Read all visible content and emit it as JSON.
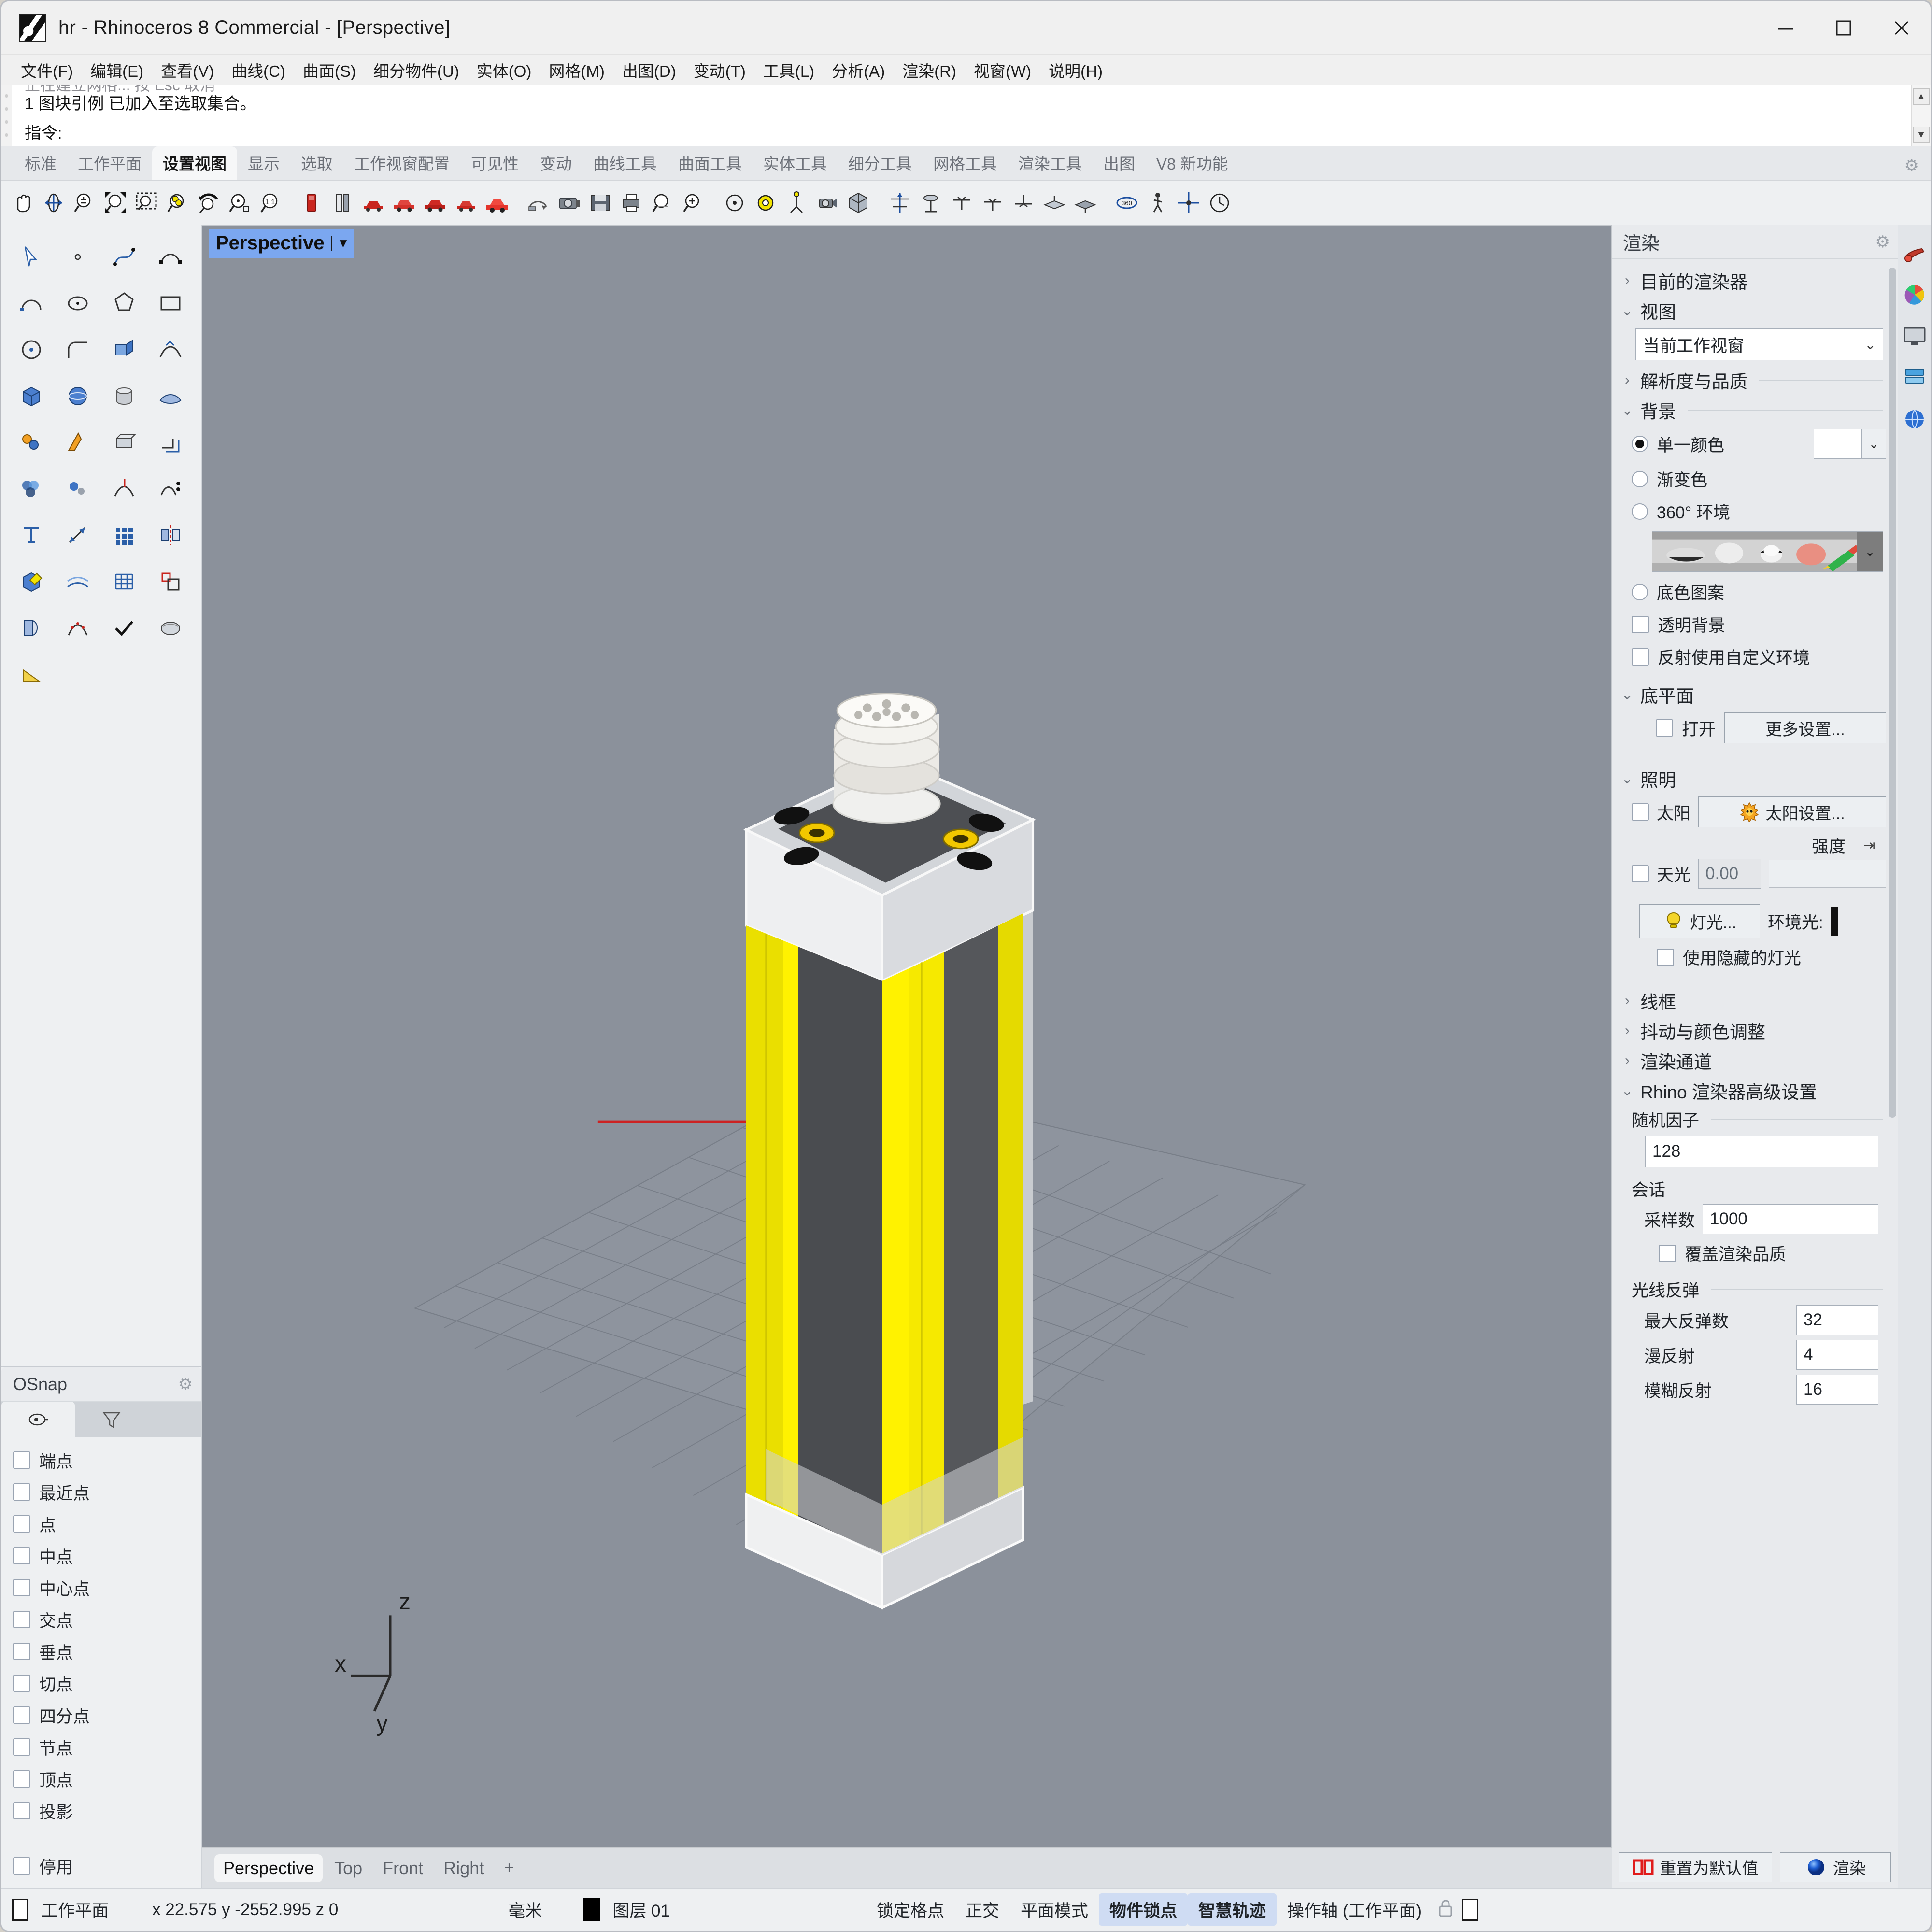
{
  "window": {
    "title": "hr - Rhinoceros 8 Commercial - [Perspective]",
    "minimize_label": "minimize",
    "maximize_label": "maximize",
    "close_label": "close"
  },
  "menubar": {
    "items": [
      {
        "label": "文件(F)"
      },
      {
        "label": "编辑(E)"
      },
      {
        "label": "查看(V)"
      },
      {
        "label": "曲线(C)"
      },
      {
        "label": "曲面(S)"
      },
      {
        "label": "细分物件(U)"
      },
      {
        "label": "实体(O)"
      },
      {
        "label": "网格(M)"
      },
      {
        "label": "出图(D)"
      },
      {
        "label": "变动(T)"
      },
      {
        "label": "工具(L)"
      },
      {
        "label": "分析(A)"
      },
      {
        "label": "渲染(R)"
      },
      {
        "label": "视窗(W)"
      },
      {
        "label": "说明(H)"
      }
    ]
  },
  "command": {
    "history_previous": "正在建立网格... 按 Esc 取消",
    "history_current": "1 图块引例 已加入至选取集合。",
    "prompt_label": "指令:",
    "input_value": ""
  },
  "toolbar_tabs": {
    "items": [
      {
        "label": "标准"
      },
      {
        "label": "工作平面"
      },
      {
        "label": "设置视图"
      },
      {
        "label": "显示"
      },
      {
        "label": "选取"
      },
      {
        "label": "工作视窗配置"
      },
      {
        "label": "可见性"
      },
      {
        "label": "变动"
      },
      {
        "label": "曲线工具"
      },
      {
        "label": "曲面工具"
      },
      {
        "label": "实体工具"
      },
      {
        "label": "细分工具"
      },
      {
        "label": "网格工具"
      },
      {
        "label": "渲染工具"
      },
      {
        "label": "出图"
      },
      {
        "label": "V8 新功能"
      }
    ],
    "active": "设置视图"
  },
  "osnap": {
    "title": "OSnap",
    "items": [
      {
        "label": "端点",
        "checked": false
      },
      {
        "label": "最近点",
        "checked": false
      },
      {
        "label": "点",
        "checked": false
      },
      {
        "label": "中点",
        "checked": false
      },
      {
        "label": "中心点",
        "checked": false
      },
      {
        "label": "交点",
        "checked": false
      },
      {
        "label": "垂点",
        "checked": false
      },
      {
        "label": "切点",
        "checked": false
      },
      {
        "label": "四分点",
        "checked": false
      },
      {
        "label": "节点",
        "checked": false
      },
      {
        "label": "顶点",
        "checked": false
      },
      {
        "label": "投影",
        "checked": false
      }
    ],
    "disable": {
      "label": "停用",
      "checked": false
    }
  },
  "viewport": {
    "label": "Perspective",
    "axis": {
      "x": "x",
      "y": "y",
      "z": "z"
    },
    "tabs": [
      {
        "label": "Perspective",
        "active": true
      },
      {
        "label": "Top",
        "active": false
      },
      {
        "label": "Front",
        "active": false
      },
      {
        "label": "Right",
        "active": false
      }
    ],
    "add_tab_label": "+"
  },
  "render_panel": {
    "title": "渲染",
    "sections": {
      "current_renderer": {
        "label": "目前的渲染器",
        "expanded": false
      },
      "view": {
        "label": "视图",
        "expanded": true,
        "select_value": "当前工作视窗"
      },
      "resolution_quality": {
        "label": "解析度与品质",
        "expanded": false
      },
      "background": {
        "label": "背景",
        "expanded": true,
        "options": [
          {
            "label": "单一颜色",
            "selected": true
          },
          {
            "label": "渐变色",
            "selected": false
          },
          {
            "label": "360° 环境",
            "selected": false
          },
          {
            "label": "底色图案",
            "selected": false
          }
        ],
        "checkboxes": [
          {
            "label": "透明背景",
            "checked": false
          },
          {
            "label": "反射使用自定义环境",
            "checked": false
          }
        ]
      },
      "ground_plane": {
        "label": "底平面",
        "expanded": true,
        "enable": {
          "label": "打开",
          "checked": false
        },
        "more_button": "更多设置..."
      },
      "lighting": {
        "label": "照明",
        "expanded": true,
        "sun": {
          "label": "太阳",
          "checked": false
        },
        "sun_settings_button": "太阳设置...",
        "intensity_label": "强度",
        "skylight": {
          "label": "天光",
          "checked": false,
          "value": "0.00"
        },
        "lights_button": "灯光...",
        "ambient_label": "环境光:",
        "use_hidden_lights": {
          "label": "使用隐藏的灯光",
          "checked": false
        }
      },
      "wireframe": {
        "label": "线框",
        "expanded": false
      },
      "dither_color": {
        "label": "抖动与颜色调整",
        "expanded": false
      },
      "render_channels": {
        "label": "渲染通道",
        "expanded": false
      },
      "advanced": {
        "label": "Rhino 渲染器高级设置",
        "expanded": true,
        "seed_label": "随机因子",
        "seed_value": "128",
        "session_label": "会话",
        "samples_label": "采样数",
        "samples_value": "1000",
        "override_quality": {
          "label": "覆盖渲染品质",
          "checked": false
        },
        "bounces_label": "光线反弹",
        "max_bounces_label": "最大反弹数",
        "max_bounces_value": "32",
        "diffuse_label": "漫反射",
        "diffuse_value": "4",
        "glossy_label": "模糊反射",
        "glossy_value": "16"
      }
    },
    "footer": {
      "reset_button": "重置为默认值",
      "render_button": "渲染"
    }
  },
  "statusbar": {
    "cplane_label": "工作平面",
    "coordinates": "x 22.575  y -2552.995  z 0",
    "units": "毫米",
    "layer": "图层 01",
    "toggles": [
      {
        "label": "锁定格点",
        "on": false
      },
      {
        "label": "正交",
        "on": false
      },
      {
        "label": "平面模式",
        "on": false
      },
      {
        "label": "物件锁点",
        "on": true
      },
      {
        "label": "智慧轨迹",
        "on": true
      },
      {
        "label": "操作轴 (工作平面)",
        "on": false
      }
    ]
  },
  "colors": {
    "accent": "#7ba7f0",
    "viewport_bg": "#8b919b",
    "model_yellow": "#f2e400",
    "model_dark": "#4a4a4a",
    "model_light": "#e9e9e9",
    "toggle_on_bg": "#cfdcf3",
    "red_axis": "#cc2222"
  },
  "icons": {
    "titlebar": [
      "rhino-logo-icon",
      "minimize-icon",
      "maximize-icon",
      "close-icon"
    ],
    "toolbar_row": [
      "pan-icon",
      "rotate-view-icon",
      "zoom-icon",
      "zoom-extents-icon",
      "zoom-window-icon",
      "zoom-selected-icon",
      "zoom-previous-icon",
      "zoom-target-icon",
      "zoom-1to1-icon",
      "named-view-icon",
      "two-view-icon",
      "car-view-1-icon",
      "car-view-2-icon",
      "car-view-3-icon",
      "car-view-4-icon",
      "car-red-icon",
      "set-view-icon",
      "camera-icon",
      "save-view-icon",
      "print-view-icon",
      "magnify-icon",
      "magnify-plus-icon",
      "target-icon",
      "gear-target-icon",
      "tripod-icon",
      "camera-box-icon",
      "cube-view-icon",
      "perspective-icon",
      "elevation-icon",
      "section-1-icon",
      "section-2-icon",
      "section-3-icon",
      "plane-1-icon",
      "plane-2-icon",
      "360-view-icon",
      "walk-icon",
      "explode-view-icon",
      "clock-view-icon"
    ],
    "left_tools": [
      "select-arrow-icon",
      "point-icon",
      "curve-icon",
      "freeform-curve-icon",
      "arc-icon",
      "ellipse-icon",
      "polygon-icon",
      "rectangle-icon",
      "circle-dot-icon",
      "fillet-icon",
      "extrude-icon",
      "sweep-icon",
      "box-icon",
      "sphere-icon",
      "cylinder-icon",
      "surface-icon",
      "join-icon",
      "boolean-icon",
      "cap-icon",
      "offset-icon",
      "blend-icon",
      "split-icon",
      "trim-icon",
      "array-icon",
      "text-icon",
      "dimension-icon",
      "grid-array-icon",
      "mirror-icon",
      "solid-edit-icon",
      "loft-icon",
      "grid-icon",
      "scale-icon",
      "unroll-icon",
      "rebuild-icon",
      "check-icon",
      "smooth-icon",
      "wedge-icon"
    ],
    "right_rail": [
      "material-icon",
      "color-wheel-icon",
      "display-icon",
      "layers-icon",
      "environment-icon"
    ]
  }
}
